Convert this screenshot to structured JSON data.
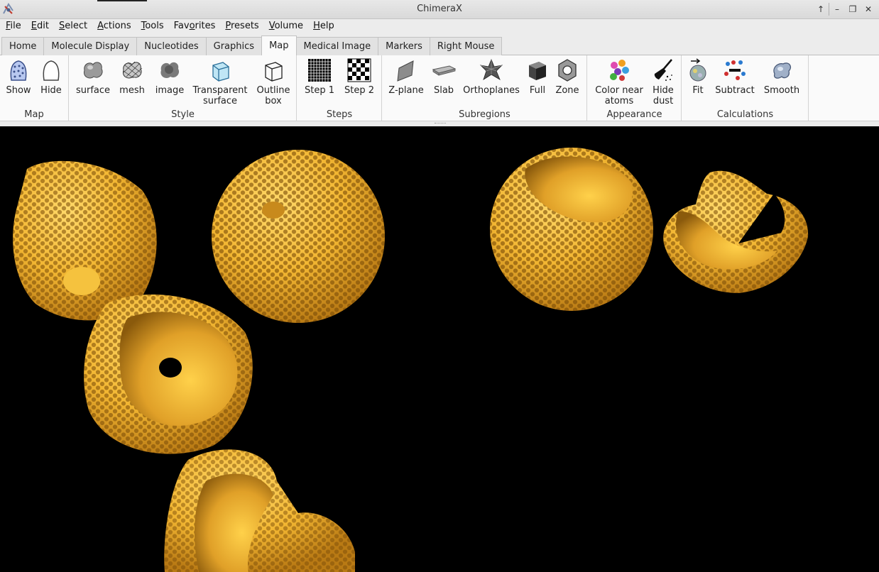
{
  "window": {
    "title": "ChimeraX"
  },
  "menubar": [
    {
      "pre": "",
      "u": "F",
      "post": "ile"
    },
    {
      "pre": "",
      "u": "E",
      "post": "dit"
    },
    {
      "pre": "",
      "u": "S",
      "post": "elect"
    },
    {
      "pre": "",
      "u": "A",
      "post": "ctions"
    },
    {
      "pre": "",
      "u": "T",
      "post": "ools"
    },
    {
      "pre": "Fav",
      "u": "o",
      "post": "rites"
    },
    {
      "pre": "",
      "u": "P",
      "post": "resets"
    },
    {
      "pre": "",
      "u": "V",
      "post": "olume"
    },
    {
      "pre": "",
      "u": "H",
      "post": "elp"
    }
  ],
  "tabs": [
    "Home",
    "Molecule Display",
    "Nucleotides",
    "Graphics",
    "Map",
    "Medical Image",
    "Markers",
    "Right Mouse"
  ],
  "active_tab": "Map",
  "toolbar": {
    "groups": {
      "map": "Map",
      "style": "Style",
      "steps": "Steps",
      "subregions": "Subregions",
      "appearance": "Appearance",
      "calculations": "Calculations"
    },
    "tools": {
      "show": "Show",
      "hide": "Hide",
      "surface": "surface",
      "mesh": "mesh",
      "image": "image",
      "transparent_1": "Transparent",
      "transparent_2": "surface",
      "outline_1": "Outline",
      "outline_2": "box",
      "step1": "Step 1",
      "step2": "Step 2",
      "zplane": "Z-plane",
      "slab": "Slab",
      "orthoplanes": "Orthoplanes",
      "full": "Full",
      "zone": "Zone",
      "colornear_1": "Color near",
      "colornear_2": "atoms",
      "hidedust_1": "Hide",
      "hidedust_2": "dust",
      "fit": "Fit",
      "subtract": "Subtract",
      "smooth": "Smooth"
    }
  },
  "colors": {
    "map_surface": "#f2b632",
    "map_shadow": "#a06a10",
    "background": "#000000"
  }
}
